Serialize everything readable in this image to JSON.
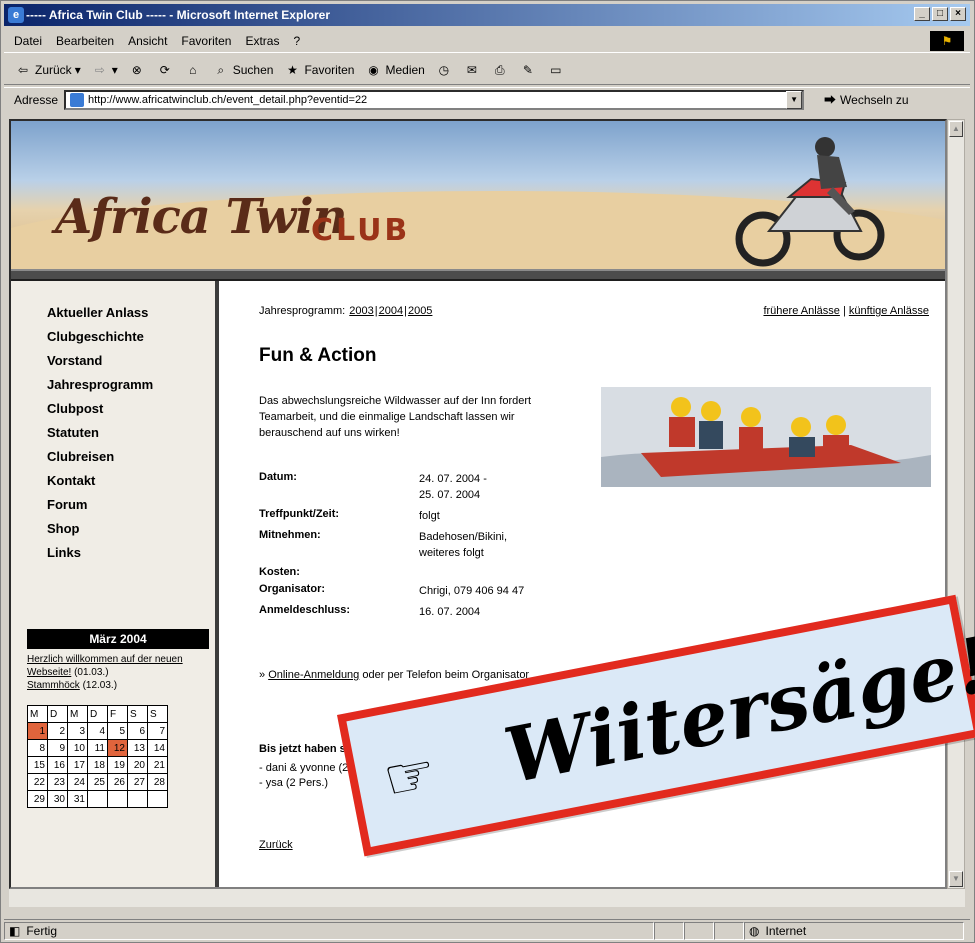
{
  "window": {
    "title": "----- Africa Twin Club ----- - Microsoft Internet Explorer",
    "controls": [
      "_",
      "□",
      "×"
    ]
  },
  "menu": [
    "Datei",
    "Bearbeiten",
    "Ansicht",
    "Favoriten",
    "Extras",
    "?"
  ],
  "toolbar": {
    "back": "Zurück",
    "search": "Suchen",
    "favorites": "Favoriten",
    "media": "Medien"
  },
  "address": {
    "label": "Adresse",
    "url": "http://www.africatwinclub.ch/event_detail.php?eventid=22",
    "go": "Wechseln zu"
  },
  "banner": {
    "logo_text": "Africa Twin",
    "logo_club": "CLUB"
  },
  "nav": [
    "Aktueller Anlass",
    "Clubgeschichte",
    "Vorstand",
    "Jahresprogramm",
    "Clubpost",
    "Statuten",
    "Clubreisen",
    "Kontakt",
    "Forum",
    "Shop",
    "Links"
  ],
  "calendar": {
    "month": "März 2004",
    "notes": [
      {
        "link": "Herzlich willkommen auf der neuen Webseite!",
        "date": "(01.03.)"
      },
      {
        "link": "Stammhöck",
        "date": "(12.03.)"
      }
    ],
    "days": [
      "M",
      "D",
      "M",
      "D",
      "F",
      "S",
      "S"
    ],
    "weeks": [
      [
        "1",
        "2",
        "3",
        "4",
        "5",
        "6",
        "7"
      ],
      [
        "8",
        "9",
        "10",
        "11",
        "12",
        "13",
        "14"
      ],
      [
        "15",
        "16",
        "17",
        "18",
        "19",
        "20",
        "21"
      ],
      [
        "22",
        "23",
        "24",
        "25",
        "26",
        "27",
        "28"
      ],
      [
        "29",
        "30",
        "31",
        "",
        "",
        "",
        ""
      ]
    ],
    "highlighted": [
      "1",
      "12"
    ]
  },
  "content": {
    "years_label": "Jahresprogramm:",
    "years": [
      "2003",
      "2004",
      "2005"
    ],
    "links_right": [
      "frühere Anlässe",
      "künftige Anlässe"
    ],
    "title": "Fun & Action",
    "intro": "Das abwechslungsreiche Wildwasser auf der Inn fordert Teamarbeit, und die einmalige Landschaft lassen wir berauschend auf uns wirken!",
    "details": [
      {
        "k": "Datum:",
        "v": "24. 07. 2004 -\n25. 07. 2004"
      },
      {
        "k": "Treffpunkt/Zeit:",
        "v": "folgt"
      },
      {
        "k": "Mitnehmen:",
        "v": "Badehosen/Bikini,\nweiteres folgt"
      },
      {
        "k": "Kosten:",
        "v": ""
      },
      {
        "k": "Organisator:",
        "v": "Chrigi, 079 406 94 47"
      },
      {
        "k": "Anmeldeschluss:",
        "v": "16. 07. 2004"
      }
    ],
    "signup_prefix": "»",
    "signup_link": "Online-Anmeldung",
    "signup_rest": "oder per Telefon beim Organisator",
    "registered_title": "Bis jetzt haben sich angemeldet:",
    "registered": [
      "- dani & yvonne (2 Pers.)",
      "- ysa (2 Pers.)"
    ],
    "back": "Zurück"
  },
  "status": {
    "text": "Fertig",
    "zone": "Internet"
  },
  "sticker": {
    "text": "Wiitersäge!",
    "hand": "☞"
  },
  "colors": {
    "accent": "#e22a1e",
    "sticker_bg": "#dbe9f7",
    "calendar_highlight": "#e0643c"
  }
}
